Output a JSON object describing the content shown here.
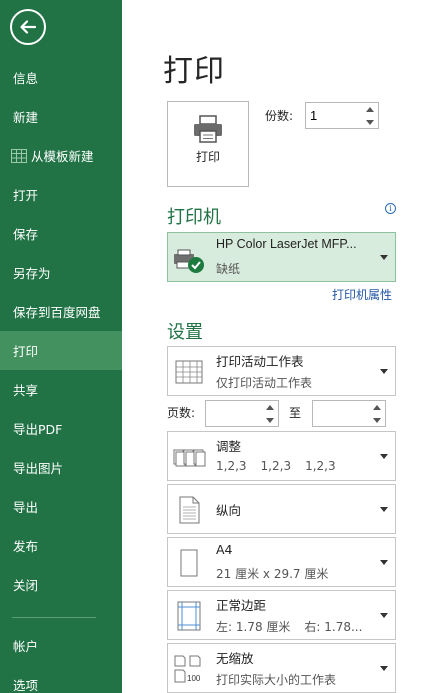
{
  "sidebar": {
    "items": [
      {
        "label": "信息"
      },
      {
        "label": "新建"
      },
      {
        "label": "从模板新建"
      },
      {
        "label": "打开"
      },
      {
        "label": "保存"
      },
      {
        "label": "另存为"
      },
      {
        "label": "保存到百度网盘"
      },
      {
        "label": "打印"
      },
      {
        "label": "共享"
      },
      {
        "label": "导出PDF"
      },
      {
        "label": "导出图片"
      },
      {
        "label": "导出"
      },
      {
        "label": "发布"
      },
      {
        "label": "关闭"
      }
    ],
    "bottom_items": [
      {
        "label": "帐户"
      },
      {
        "label": "选项"
      }
    ],
    "active_item": "打印",
    "colors": {
      "background": "#217346",
      "active": "#43915f"
    }
  },
  "page": {
    "title": "打印"
  },
  "print_button": {
    "label": "打印"
  },
  "copies": {
    "label": "份数:",
    "value": "1"
  },
  "printer": {
    "section_title": "打印机",
    "name": "HP Color LaserJet MFP...",
    "status": "缺纸",
    "properties_link": "打印机属性",
    "info_icon": "i"
  },
  "settings": {
    "section_title": "设置",
    "print_what": {
      "title": "打印活动工作表",
      "subtitle": "仅打印活动工作表"
    },
    "pages": {
      "label": "页数:",
      "from": "",
      "to_label": "至",
      "to": ""
    },
    "collate": {
      "title": "调整",
      "values": [
        "1,2,3",
        "1,2,3",
        "1,2,3"
      ]
    },
    "orientation": {
      "title": "纵向"
    },
    "paper": {
      "title": "A4",
      "subtitle": "21 厘米 x 29.7 厘米"
    },
    "margins": {
      "title": "正常边距",
      "left": "左:  1.78 厘米",
      "right": "右:  1.78..."
    },
    "scaling": {
      "title": "无缩放",
      "subtitle": "打印实际大小的工作表",
      "icon_text": "100"
    }
  },
  "accent_color": "#217346",
  "link_color": "#2356a6"
}
